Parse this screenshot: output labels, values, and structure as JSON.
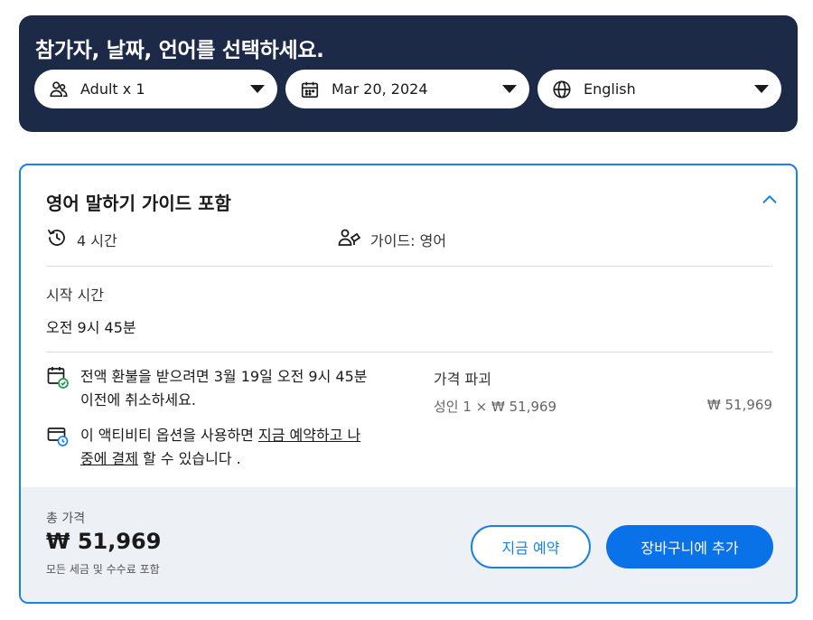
{
  "selector": {
    "title": "참가자, 날짜, 언어를 선택하세요.",
    "participants": {
      "label": "Adult x 1",
      "icon": "people-icon"
    },
    "date": {
      "label": "Mar 20, 2024",
      "icon": "calendar-icon"
    },
    "language": {
      "label": "English",
      "icon": "globe-icon"
    }
  },
  "option": {
    "title": "영어 말하기 가이드 포함",
    "duration": "4 시간",
    "guide": "가이드: 영어",
    "start_label": "시작 시간",
    "start_time": "오전 9시 45분",
    "refund_text": "전액 환불을 받으려면 3월 19일 오전 9시 45분 이전에 취소하세요.",
    "reserve_prefix": "이 액티비티 옵션을 사용하면 ",
    "reserve_link": "지금 예약하고 나중에 결제",
    "reserve_suffix": " 할 수 있습니다 .",
    "price_heading": "가격 파괴",
    "price_detail": "성인 1 × ₩ 51,969",
    "price_amount": "₩ 51,969"
  },
  "footer": {
    "total_label": "총 가격",
    "total_value": "₩ 51,969",
    "total_note": "모든 세금 및 수수료 포함",
    "reserve_button": "지금 예약",
    "cart_button": "장바구니에 추가"
  },
  "colors": {
    "panel": "#1c2a47",
    "accent": "#1a82e2",
    "primary_button": "#0a72e8",
    "footer_bg": "#edf0f4"
  }
}
